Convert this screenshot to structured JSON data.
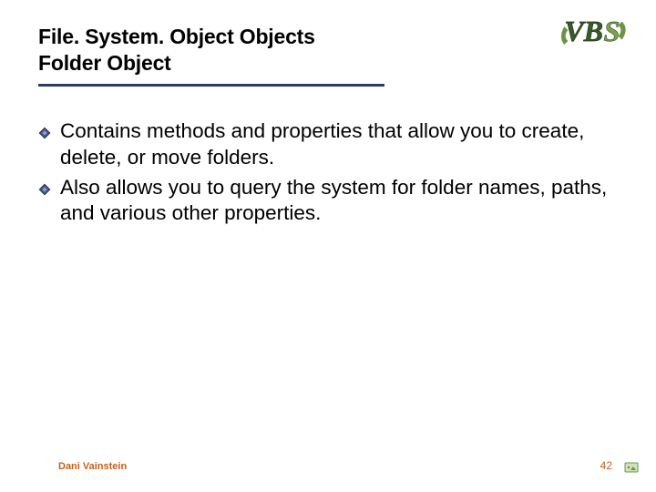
{
  "title": {
    "line1": "File. System. Object Objects",
    "line2": "Folder Object"
  },
  "bullets": [
    "Contains methods and properties that allow you to create, delete, or move folders.",
    "Also allows you to query the system for folder names, paths, and various other properties."
  ],
  "footer": {
    "author": "Dani Vainstein",
    "page": "42"
  },
  "logo_text": "VBS"
}
